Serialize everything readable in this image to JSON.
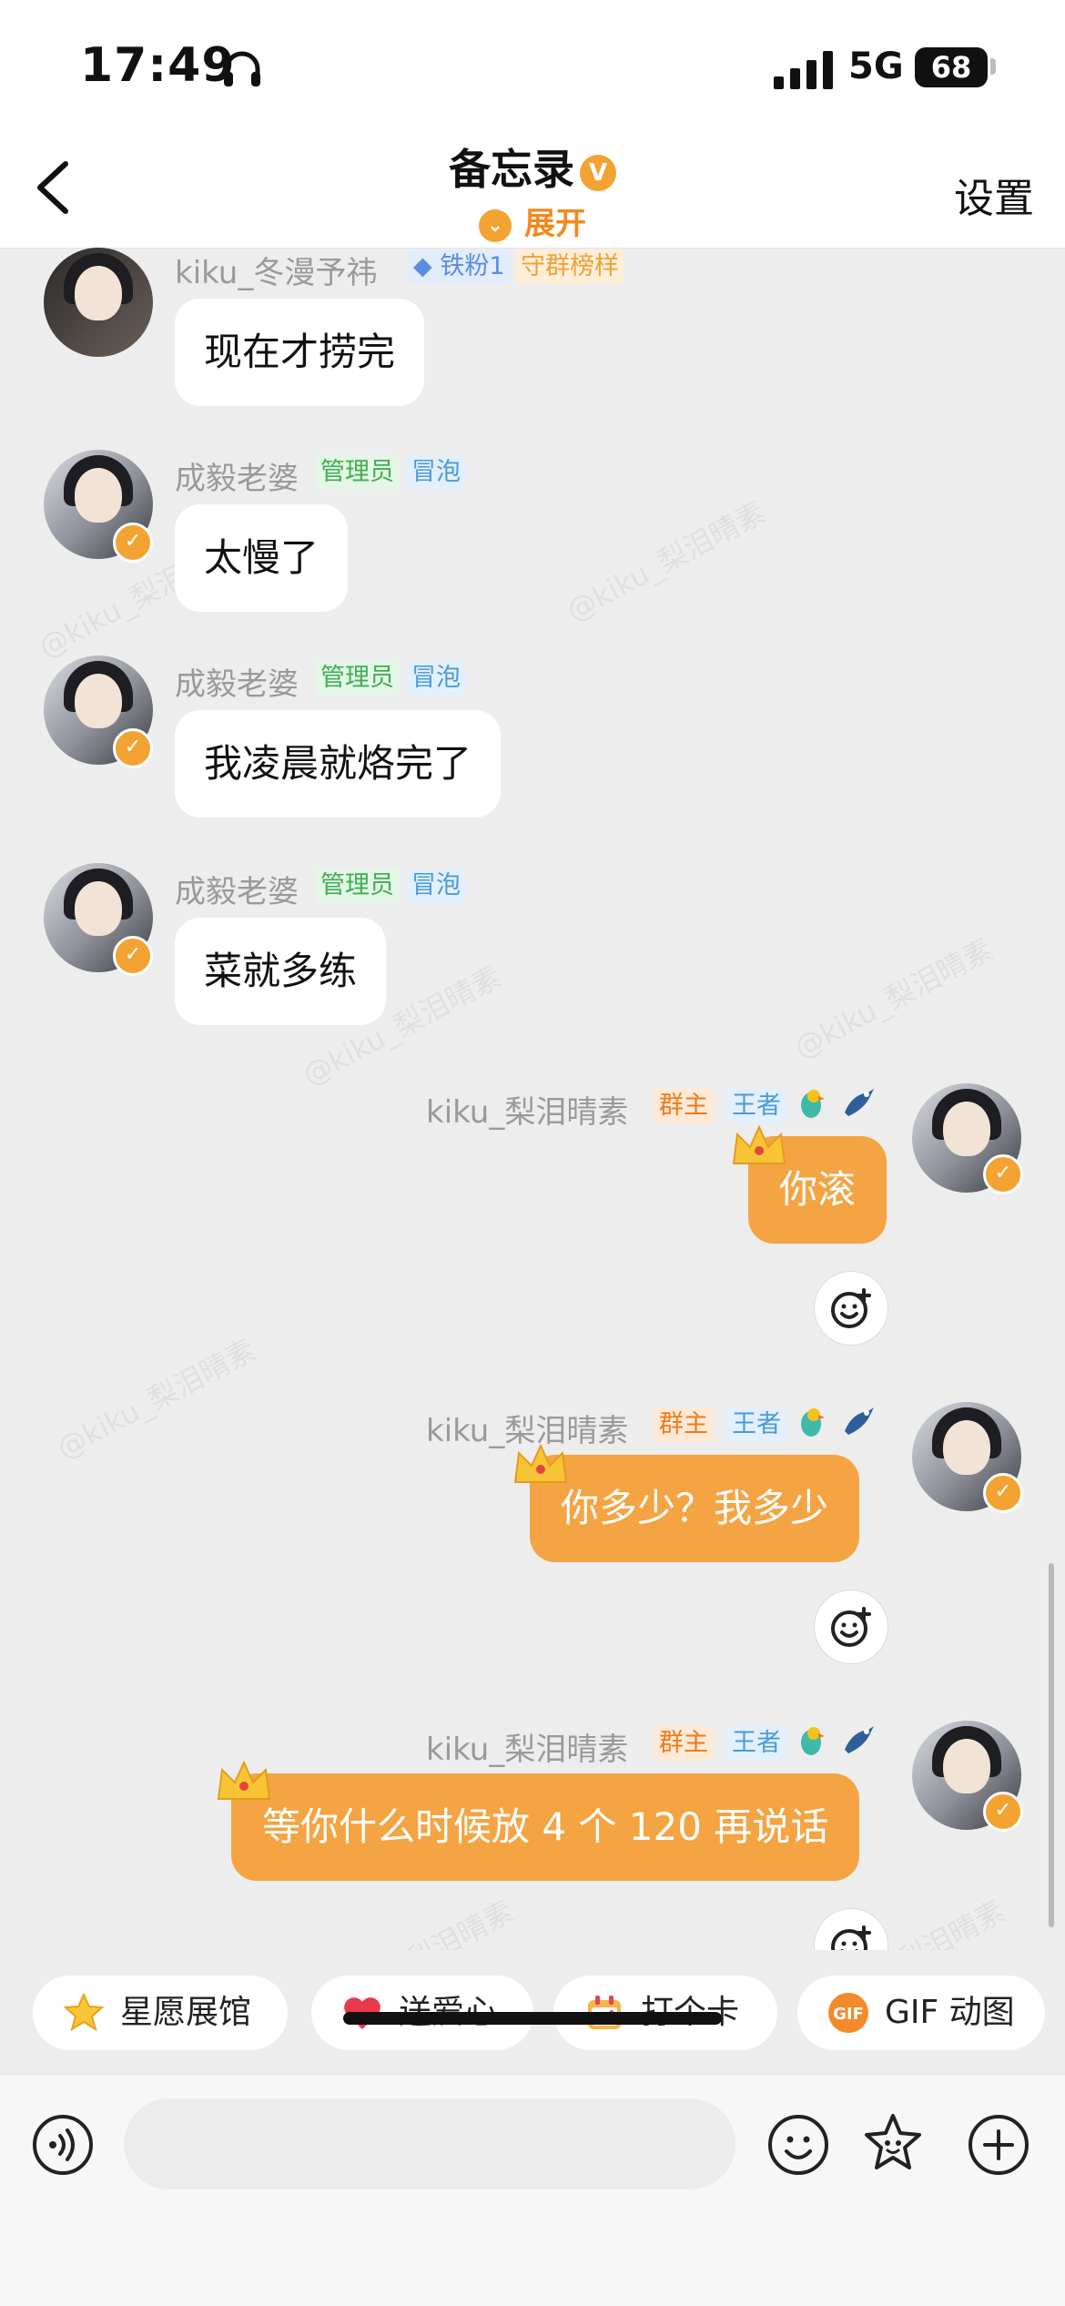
{
  "status": {
    "time": "17:49",
    "network": "5G",
    "battery": "68"
  },
  "nav": {
    "title": "备忘录",
    "expand": "展开",
    "settings": "设置",
    "title_badge": "V"
  },
  "messages": [
    {
      "side": "left",
      "name": "kiku_冬漫予祎",
      "tags": [
        "铁粉1",
        "守群榜样"
      ],
      "text": "现在才捞完"
    },
    {
      "side": "left",
      "name": "成毅老婆",
      "tags": [
        "管理员",
        "冒泡"
      ],
      "text": "太慢了"
    },
    {
      "side": "left",
      "name": "成毅老婆",
      "tags": [
        "管理员",
        "冒泡"
      ],
      "text": "我凌晨就烙完了"
    },
    {
      "side": "left",
      "name": "成毅老婆",
      "tags": [
        "管理员",
        "冒泡"
      ],
      "text": "菜就多练"
    },
    {
      "side": "right",
      "name": "kiku_梨泪晴素",
      "tags": [
        "群主",
        "王者"
      ],
      "text": "你滚"
    },
    {
      "side": "right",
      "name": "kiku_梨泪晴素",
      "tags": [
        "群主",
        "王者"
      ],
      "text": "你多少？我多少"
    },
    {
      "side": "right",
      "name": "kiku_梨泪晴素",
      "tags": [
        "群主",
        "王者"
      ],
      "text": "等你什么时候放 4 个 120 再说话"
    }
  ],
  "watermarks": [
    "@kiku_梨泪晴素",
    "@kiku_梨泪晴素",
    "@kiku_梨泪晴素",
    "@kiku_梨泪晴素",
    "@kiku_梨泪晴素",
    "梨泪晴素",
    "梨泪晴素"
  ],
  "quick_actions": [
    {
      "label": "星愿展馆",
      "icon": "star-icon"
    },
    {
      "label": "送爱心",
      "icon": "heart-icon"
    },
    {
      "label": "打个卡",
      "icon": "calendar-icon"
    },
    {
      "label": "GIF 动图",
      "icon": "gif-icon"
    }
  ],
  "input": {
    "placeholder": ""
  },
  "colors": {
    "accent": "#f4a443",
    "badge": "#f3a332",
    "bg": "#ededed"
  }
}
